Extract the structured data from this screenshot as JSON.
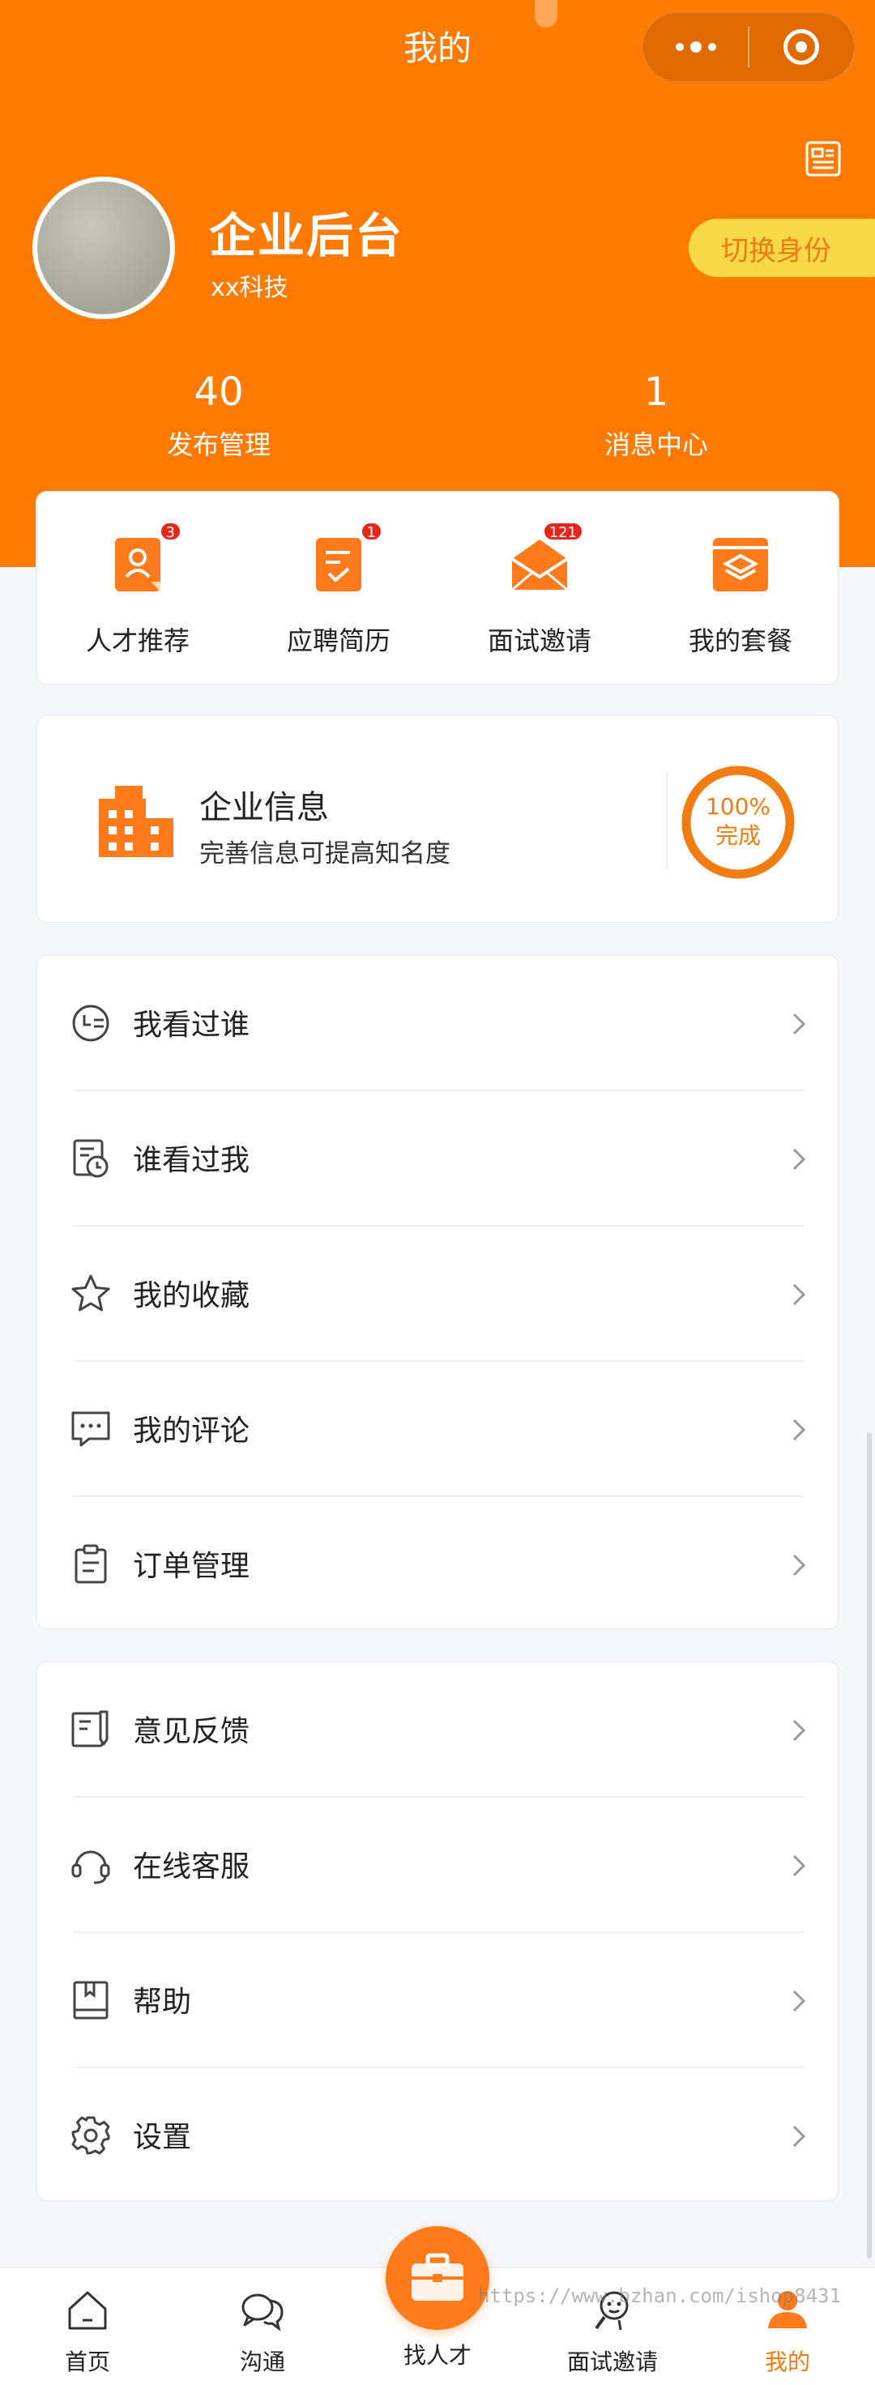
{
  "header": {
    "title": "我的",
    "menu_icon": "more-dots-icon",
    "close_icon": "target-icon",
    "qr_icon": "qr-code-icon"
  },
  "profile": {
    "company_name": "企业后台",
    "company_sub": "xx科技",
    "switch_label": "切换身份"
  },
  "stats": [
    {
      "value": "40",
      "label": "发布管理"
    },
    {
      "value": "1",
      "label": "消息中心"
    }
  ],
  "quick_actions": [
    {
      "label": "人才推荐",
      "badge": "3",
      "icon": "talent-icon"
    },
    {
      "label": "应聘简历",
      "badge": "1",
      "icon": "resume-icon"
    },
    {
      "label": "面试邀请",
      "badge": "121",
      "icon": "mail-icon"
    },
    {
      "label": "我的套餐",
      "badge": "",
      "icon": "package-icon"
    }
  ],
  "company_info": {
    "title": "企业信息",
    "subtitle": "完善信息可提高知名度",
    "progress_label_1": "100%",
    "progress_label_2": "完成",
    "progress": 1.0
  },
  "menu_group_1": [
    {
      "label": "我看过谁",
      "icon": "history-icon"
    },
    {
      "label": "谁看过我",
      "icon": "viewer-clock-icon"
    },
    {
      "label": "我的收藏",
      "icon": "star-icon"
    },
    {
      "label": "我的评论",
      "icon": "comment-icon"
    },
    {
      "label": "订单管理",
      "icon": "clipboard-icon"
    }
  ],
  "menu_group_2": [
    {
      "label": "意见反馈",
      "icon": "feedback-icon"
    },
    {
      "label": "在线客服",
      "icon": "headset-icon"
    },
    {
      "label": "帮助",
      "icon": "book-icon"
    },
    {
      "label": "设置",
      "icon": "gear-icon"
    }
  ],
  "tabbar": [
    {
      "label": "首页",
      "icon": "home-icon"
    },
    {
      "label": "沟通",
      "icon": "chat-icon"
    },
    {
      "label": "找人才",
      "icon": "briefcase-icon"
    },
    {
      "label": "面试邀请",
      "icon": "interview-icon"
    },
    {
      "label": "我的",
      "icon": "profile-icon"
    }
  ],
  "watermark": "https://www.bzhan.com/ishop8431",
  "colors": {
    "primary": "#ff7a00",
    "accent_yellow": "#f7d948",
    "badge_red": "#e5261b"
  }
}
